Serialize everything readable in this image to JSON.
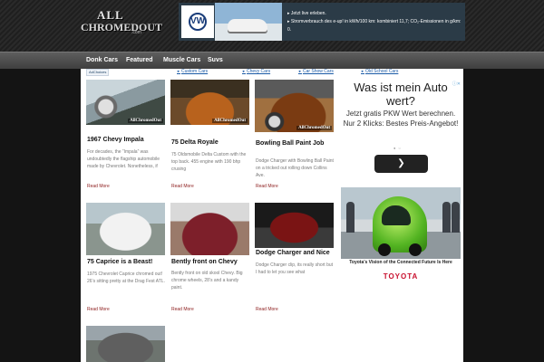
{
  "logo": {
    "line1": "ALL",
    "line2": "CHROMEDOUT",
    "line3": ".com"
  },
  "top_ad": {
    "brand_icon": "vw-logo-icon",
    "brand_mark": "VW",
    "lines": [
      "Jetzt live erleben.",
      "Stromverbrauch des e-up! in kWh/100 km: kombiniert 11,7; CO₂-Emissionen in g/km: 0."
    ]
  },
  "nav": [
    {
      "label": "Donk Cars"
    },
    {
      "label": "Featured"
    },
    {
      "label": "Muscle Cars"
    },
    {
      "label": "Suvs"
    }
  ],
  "adchoices": "AdChoices",
  "top_links": [
    "Custom Cars",
    "Chevy Cars",
    "Car Show Cars",
    "Old School Cars"
  ],
  "cards": [
    {
      "title": "1967 Chevy Impala",
      "excerpt": "For decades, the “Impala” was undoubtedly the flagship automobile made by Chevrolet. Nonetheless, if",
      "more": "Read More",
      "watermark": "AllChromedOut"
    },
    {
      "title": "75 Delta Royale",
      "excerpt": "75 Oldsmobile Delta Custom with the top back. 455 engine with 190 bhp crusing",
      "more": "Read More",
      "watermark": "AllChromedOut"
    },
    {
      "title": "Bowling Ball Paint Job",
      "excerpt": "Dodge Charger with Bowling Ball Paint on a tricked out rolling down Collins Ave.",
      "more": "Read More",
      "watermark": "AllChromedOut"
    },
    {
      "title": "75 Caprice is a Beast!",
      "excerpt": "1975 Chevrolet Caprice chromed out! 26’s sitting pretty at the Drag Fest ATL.",
      "more": "Read More",
      "watermark": ""
    },
    {
      "title": "Bently front on Chevy",
      "excerpt": "Bently front on old skool Chevy. Big chrome wheels, 28’s and a kandy paint.",
      "more": "Read More",
      "watermark": ""
    },
    {
      "title": "Dodge Charger and Nice",
      "excerpt": "Dodge Charger clip, its really short but I had to let you see what",
      "more": "Read More",
      "watermark": ""
    },
    {
      "title": "",
      "excerpt": "",
      "more": "",
      "watermark": ""
    }
  ],
  "right_ad_1": {
    "headline": "Was ist mein Auto wert?",
    "body": "Jetzt gratis PKW Wert berechnen. Nur 2 Klicks: Bestes Preis-Angebot!",
    "button_icon": "chevron-right-icon",
    "info_icon": "ad-info-icon"
  },
  "right_ad_2": {
    "caption": "Toyota’s Vision of the Connected Future Is Here",
    "brand": "TOYOTA"
  },
  "colors": {
    "link": "#1a5aa6",
    "read_more": "#8b1a1a",
    "toyota_red": "#c8102e",
    "nav_bg": "#4e4e4e"
  }
}
